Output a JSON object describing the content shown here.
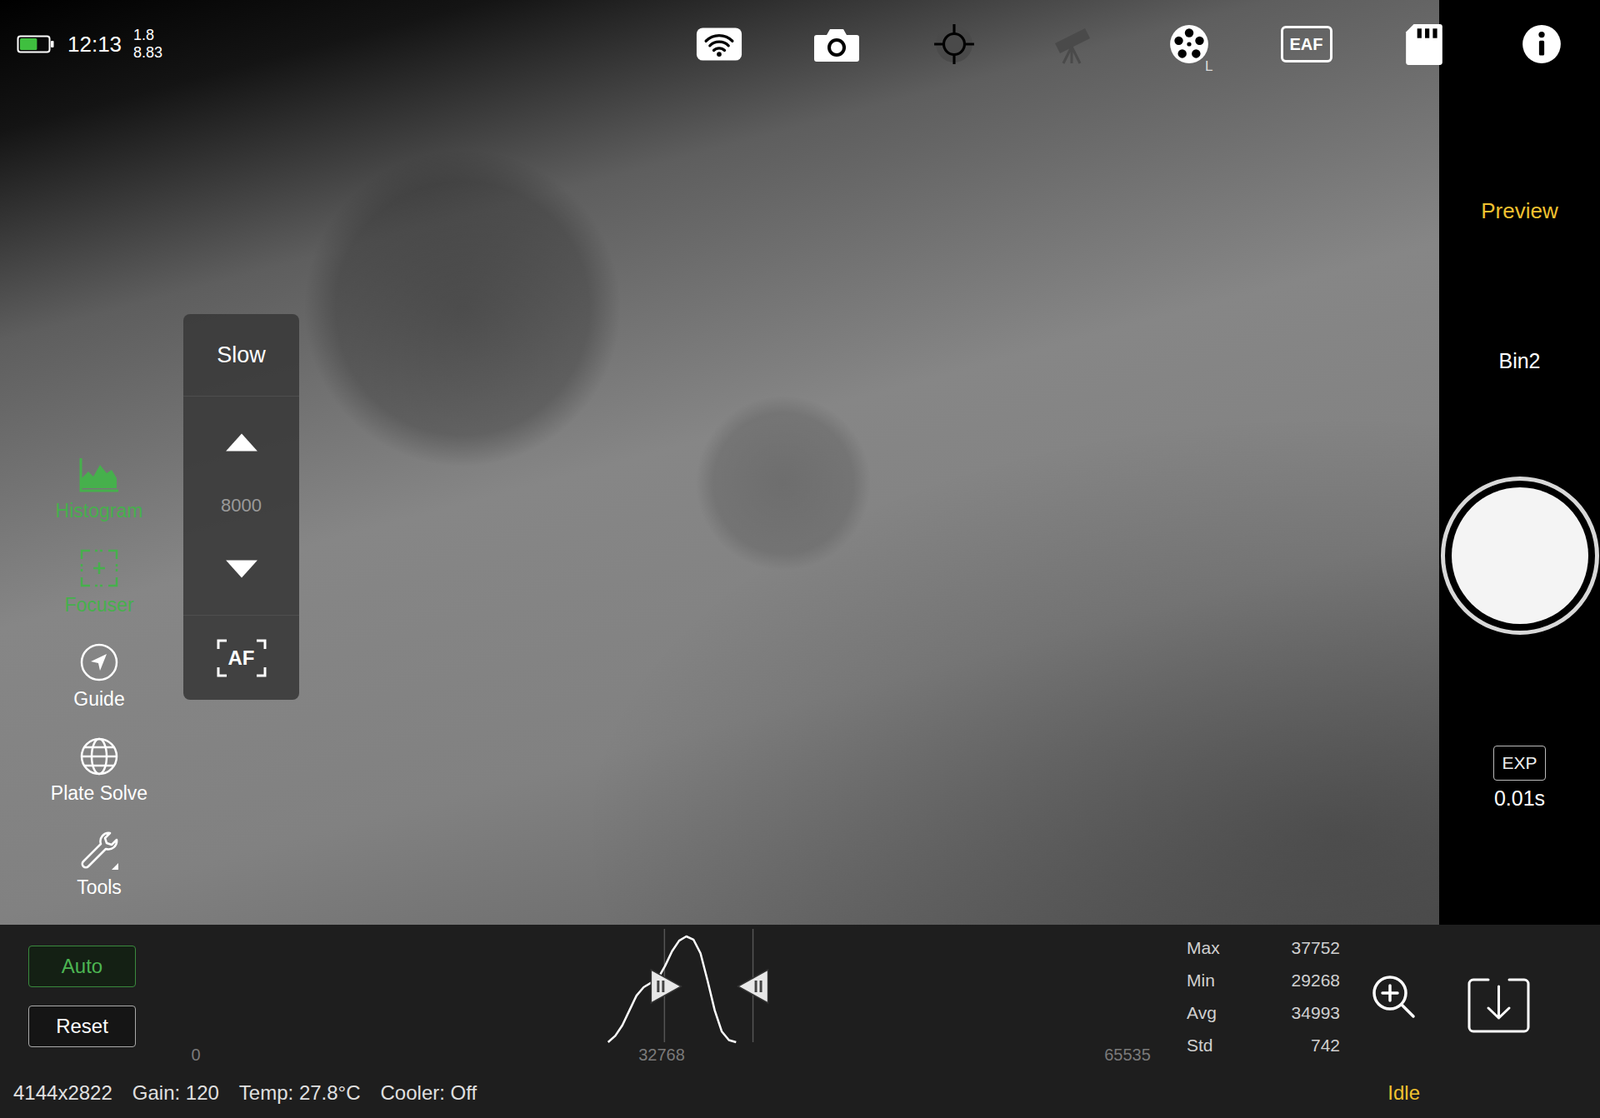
{
  "top_bar": {
    "time": "12:13",
    "readings": [
      "1.8",
      "8.83"
    ],
    "battery_level": 0.6
  },
  "device_icons": [
    {
      "kind": "wifi",
      "enabled": true
    },
    {
      "kind": "camera",
      "enabled": true
    },
    {
      "kind": "guide",
      "enabled": false
    },
    {
      "kind": "telescope",
      "enabled": false
    },
    {
      "kind": "filter-wheel",
      "enabled": true,
      "badge": "L"
    },
    {
      "kind": "eaf",
      "enabled": true,
      "label": "EAF"
    },
    {
      "kind": "sd-card",
      "enabled": true
    },
    {
      "kind": "info",
      "enabled": true
    }
  ],
  "tools": [
    {
      "kind": "histogram",
      "label": "Histogram",
      "active": true
    },
    {
      "kind": "focuser",
      "label": "Focuser",
      "active": true
    },
    {
      "kind": "guide",
      "label": "Guide",
      "active": false
    },
    {
      "kind": "plate-solve",
      "label": "Plate Solve",
      "active": false
    },
    {
      "kind": "tools",
      "label": "Tools",
      "active": false
    }
  ],
  "focuser": {
    "speed": "Slow",
    "position": "8000",
    "autofocus": "AF"
  },
  "side_panel": {
    "mode": "Preview",
    "binning": "Bin2",
    "exposure_label": "EXP",
    "exposure": "0.01s"
  },
  "histogram": {
    "axis_labels": [
      "0",
      "32768",
      "65535"
    ],
    "bin_start": 29000,
    "bin_width": 500,
    "counts": [
      0,
      6,
      16,
      30,
      44,
      52,
      56,
      60,
      72,
      86,
      96,
      100,
      97,
      84,
      58,
      30,
      10,
      2,
      0
    ],
    "black_point": 0.503,
    "white_point": 0.598
  },
  "buttons": [
    {
      "label": "Auto",
      "selected": true
    },
    {
      "label": "Reset",
      "selected": false
    }
  ],
  "stats": [
    {
      "label": "Max",
      "value": "37752"
    },
    {
      "label": "Min",
      "value": "29268"
    },
    {
      "label": "Avg",
      "value": "34993"
    },
    {
      "label": "Std",
      "value": "742"
    }
  ],
  "status_bar": {
    "items": [
      "4144x2822",
      "Gain: 120",
      "Temp: 27.8°C",
      "Cooler: Off"
    ],
    "state": "Idle"
  }
}
